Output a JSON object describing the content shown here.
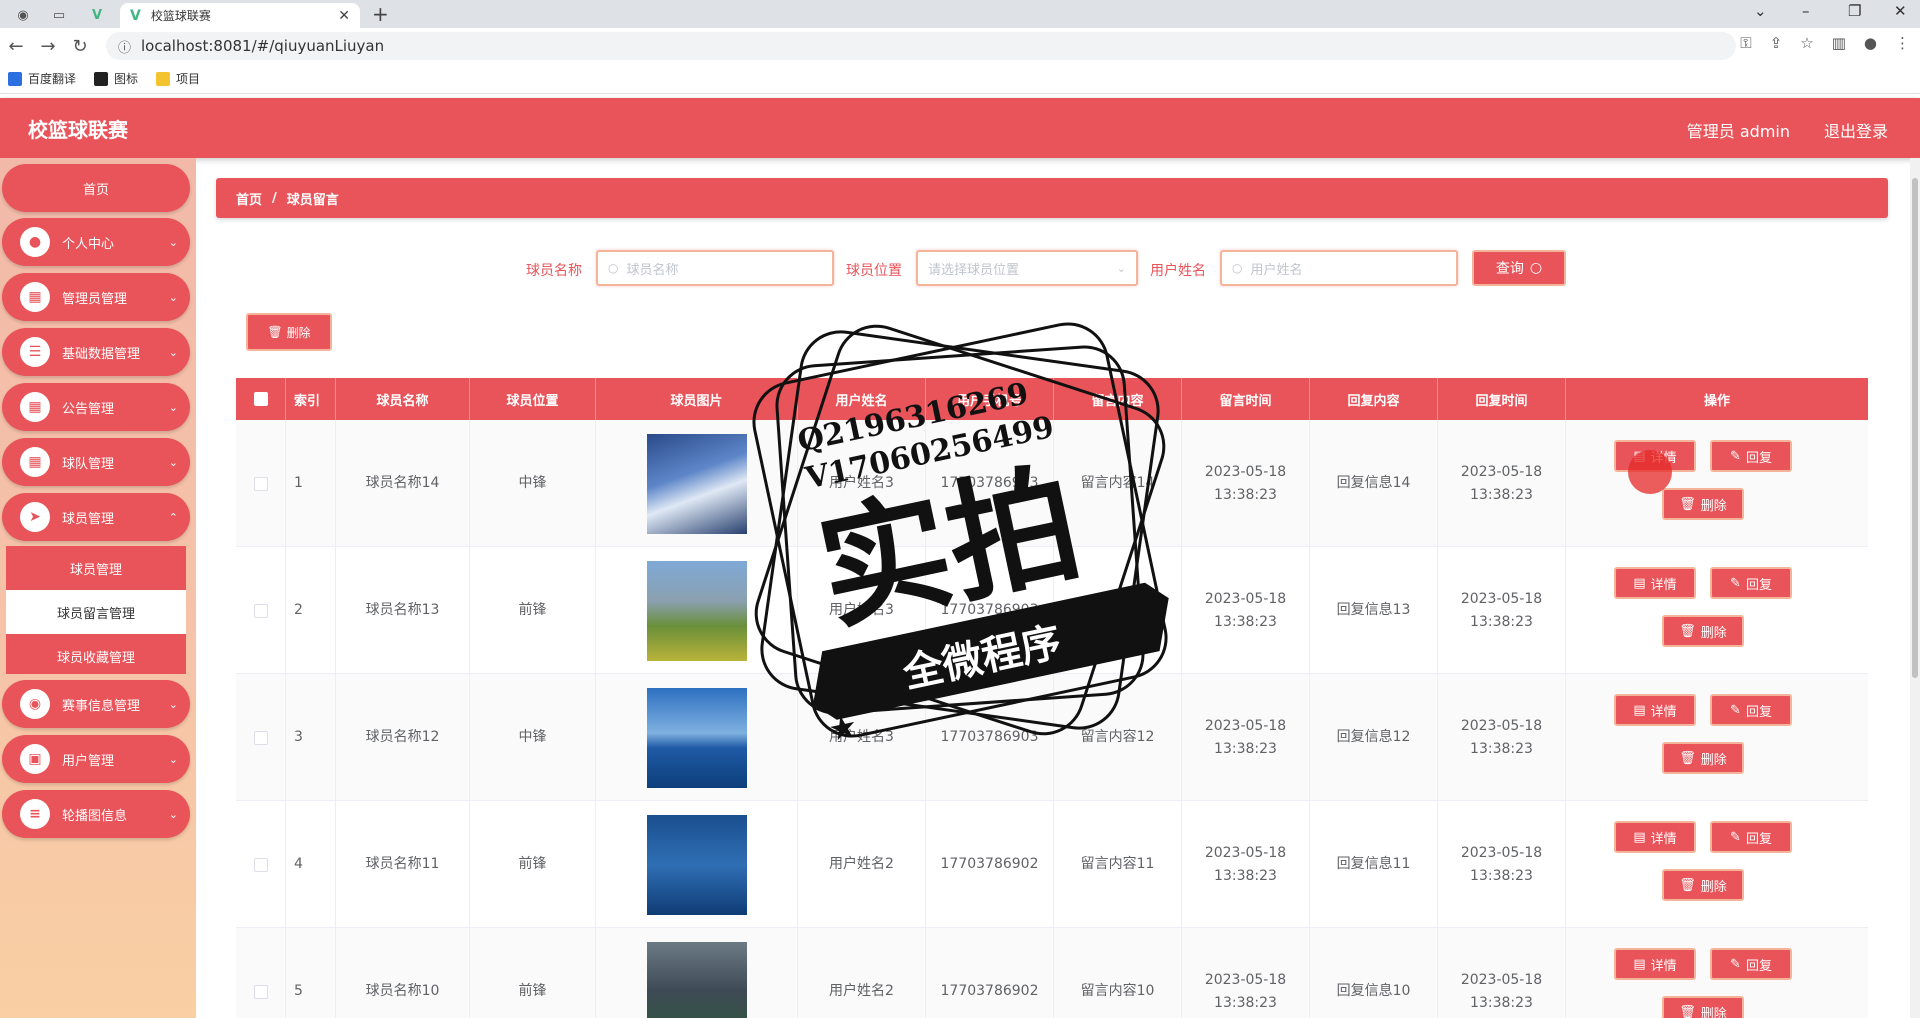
{
  "browser": {
    "tab_title": "校篮球联赛",
    "url": "localhost:8081/#/qiuyuanLiuyan",
    "bookmarks": [
      "百度翻译",
      "图标",
      "项目"
    ]
  },
  "header": {
    "title": "校篮球联赛",
    "user": "管理员 admin",
    "logout": "退出登录"
  },
  "sidebar": {
    "home": "首页",
    "items": [
      {
        "label": "个人中心",
        "icon": "user-icon"
      },
      {
        "label": "管理员管理",
        "icon": "grid-icon"
      },
      {
        "label": "基础数据管理",
        "icon": "list-icon"
      },
      {
        "label": "公告管理",
        "icon": "grid-icon"
      },
      {
        "label": "球队管理",
        "icon": "grid-icon"
      },
      {
        "label": "球员管理",
        "icon": "send-icon"
      },
      {
        "label": "赛事信息管理",
        "icon": "location-icon"
      },
      {
        "label": "用户管理",
        "icon": "wallet-icon"
      },
      {
        "label": "轮播图信息",
        "icon": "sliders-icon"
      }
    ],
    "submenu": [
      "球员管理",
      "球员留言管理",
      "球员收藏管理"
    ]
  },
  "breadcrumb": {
    "home": "首页",
    "sep": "/",
    "current": "球员留言"
  },
  "search": {
    "name_label": "球员名称",
    "name_placeholder": "球员名称",
    "position_label": "球员位置",
    "position_placeholder": "请选择球员位置",
    "user_label": "用户姓名",
    "user_placeholder": "用户姓名",
    "query_button": "查询"
  },
  "toolbar": {
    "delete_label": "删除"
  },
  "table": {
    "headers": [
      "索引",
      "球员名称",
      "球员位置",
      "球员图片",
      "用户姓名",
      "用户手机号",
      "留言内容",
      "留言时间",
      "回复内容",
      "回复时间",
      "操作"
    ],
    "rows": [
      {
        "index": "1",
        "name": "球员名称14",
        "position": "中锋",
        "user": "用户姓名3",
        "phone": "17703786903",
        "content": "留言内容14",
        "time": "2023-05-18 13:38:23",
        "reply": "回复信息14",
        "reply_time": "2023-05-18 13:38:23"
      },
      {
        "index": "2",
        "name": "球员名称13",
        "position": "前锋",
        "user": "用户姓名3",
        "phone": "17703786903",
        "content": "留言内容13",
        "time": "2023-05-18 13:38:23",
        "reply": "回复信息13",
        "reply_time": "2023-05-18 13:38:23"
      },
      {
        "index": "3",
        "name": "球员名称12",
        "position": "中锋",
        "user": "用户姓名3",
        "phone": "17703786903",
        "content": "留言内容12",
        "time": "2023-05-18 13:38:23",
        "reply": "回复信息12",
        "reply_time": "2023-05-18 13:38:23"
      },
      {
        "index": "4",
        "name": "球员名称11",
        "position": "前锋",
        "user": "用户姓名2",
        "phone": "17703786902",
        "content": "留言内容11",
        "time": "2023-05-18 13:38:23",
        "reply": "回复信息11",
        "reply_time": "2023-05-18 13:38:23"
      },
      {
        "index": "5",
        "name": "球员名称10",
        "position": "前锋",
        "user": "用户姓名2",
        "phone": "17703786902",
        "content": "留言内容10",
        "time": "2023-05-18 13:38:23",
        "reply": "回复信息10",
        "reply_time": "2023-05-18 13:38:23"
      }
    ],
    "actions": {
      "detail": "详情",
      "reply": "回复",
      "delete": "删除"
    }
  },
  "watermark": {
    "line1": "Q2196316269",
    "line2": "V17060256499",
    "big": "实拍",
    "ribbon": "全微程序"
  },
  "colors": {
    "accent": "#e8545a",
    "border": "#f3b49a"
  }
}
